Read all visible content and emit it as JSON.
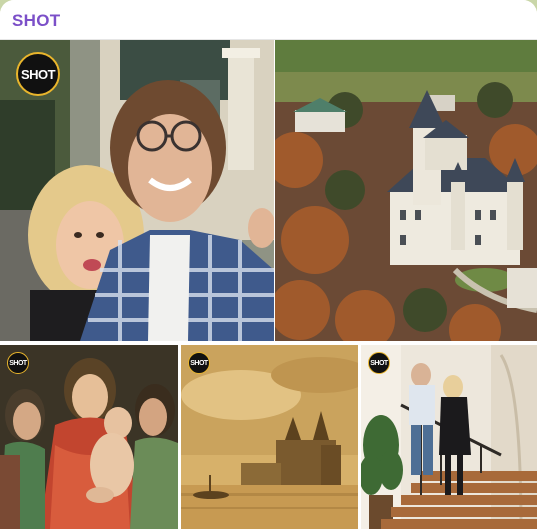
{
  "channel": {
    "name": "SHOT"
  },
  "album": {
    "watermark_label": "SHOT",
    "photos": [
      {
        "id": 1,
        "icon": "selfie-couple-photo"
      },
      {
        "id": 2,
        "icon": "castle-aerial-photo"
      },
      {
        "id": 3,
        "icon": "renaissance-painting-photo"
      },
      {
        "id": 4,
        "icon": "sepia-castle-painting-photo"
      },
      {
        "id": 5,
        "icon": "staircase-couple-photo"
      }
    ]
  },
  "colors": {
    "channel_name": "#7b4fc8",
    "logo_ring": "#e9b52c"
  }
}
